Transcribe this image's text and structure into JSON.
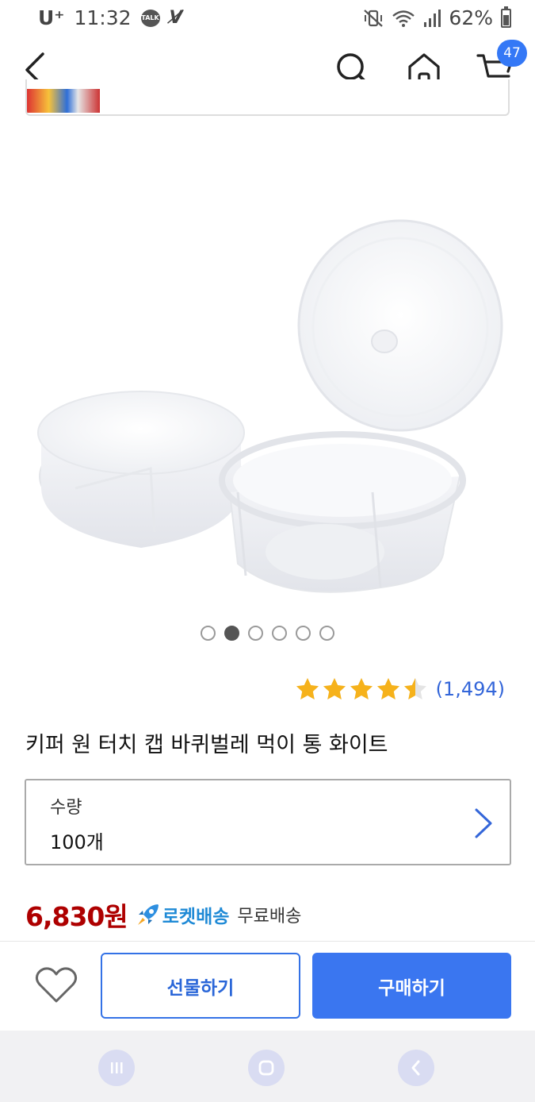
{
  "status_bar": {
    "carrier": "U⁺",
    "time": "11:32",
    "talk_badge": "TALK",
    "battery_percent": "62%",
    "battery_level": 0.62,
    "icons": [
      "kakaotalk-icon",
      "v3-icon",
      "mute-vibrate-icon",
      "wifi-icon",
      "signal-icon",
      "battery-icon"
    ]
  },
  "header": {
    "cart_count": "47",
    "icons": [
      "back-icon",
      "search-icon",
      "home-icon",
      "cart-icon"
    ]
  },
  "banner": {
    "text": " "
  },
  "carousel": {
    "total": 6,
    "active_index": 1
  },
  "product": {
    "rating_stars": 4.5,
    "review_count": "(1,494)",
    "title": "키퍼 원 터치 캡 바퀴벌레 먹이 통 화이트"
  },
  "option": {
    "label": "수량",
    "value": "100개"
  },
  "price": {
    "amount": "6,830원",
    "rocket_label": "로켓배송",
    "shipping": "무료배송"
  },
  "actions": {
    "gift_label": "선물하기",
    "buy_label": "구매하기"
  },
  "colors": {
    "accent": "#3a76f0",
    "price": "#ae0000",
    "rocket": "#1f8ad6",
    "star": "#f6b21b",
    "review": "#3466d9"
  }
}
